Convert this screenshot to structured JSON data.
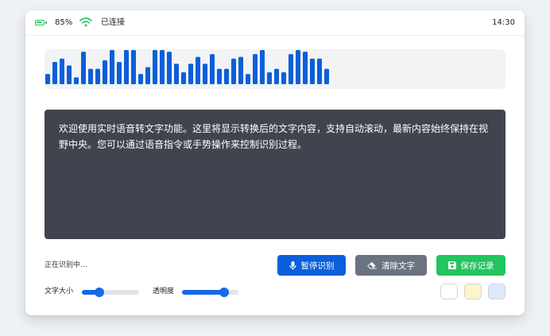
{
  "status": {
    "battery": "85%",
    "connection": "已连接",
    "time": "14:30"
  },
  "waveform": {
    "color": "#0b5fd9",
    "levels": [
      0.3,
      0.65,
      0.75,
      0.55,
      0.2,
      0.95,
      0.45,
      0.45,
      0.7,
      1.0,
      0.65,
      1.0,
      1.0,
      0.3,
      0.5,
      1.0,
      1.0,
      0.95,
      0.6,
      0.35,
      0.6,
      0.8,
      0.6,
      0.88,
      0.45,
      0.45,
      0.75,
      0.8,
      0.3,
      0.88,
      1.0,
      0.35,
      0.45,
      0.35,
      0.88,
      1.0,
      0.95,
      0.75,
      0.75,
      0.45
    ]
  },
  "display": {
    "text": "欢迎使用实时语音转文字功能。这里将显示转换后的文字内容，支持自动滚动，最新内容始终保持在视野中央。您可以通过语音指令或手势操作来控制识别过程。",
    "background": "#41444f"
  },
  "controls": {
    "status_label": "正在识别中...",
    "pause_label": "暂停识别",
    "clear_label": "清除文字",
    "save_label": "保存记录",
    "font_size_label": "文字大小",
    "font_size_value": 0.3,
    "opacity_label": "透明度",
    "opacity_value": 0.75
  },
  "swatches": [
    {
      "name": "white",
      "color": "#ffffff"
    },
    {
      "name": "yellow",
      "color": "#fdf5c7"
    },
    {
      "name": "blue",
      "color": "#dde9fb"
    }
  ],
  "colors": {
    "accent": "#0b5fd9",
    "success": "#22c55e",
    "neutral": "#6b7280"
  }
}
